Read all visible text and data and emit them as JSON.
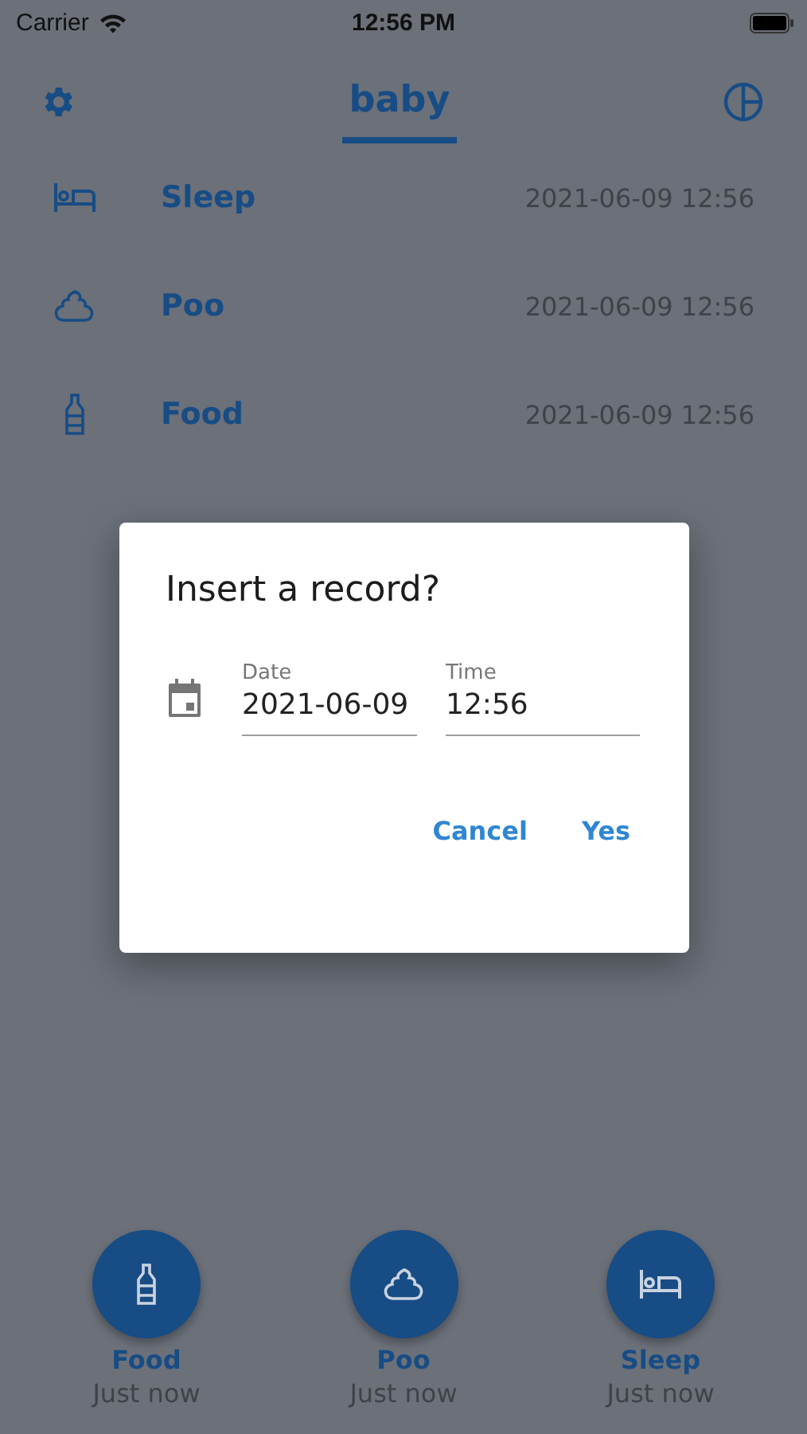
{
  "status_bar": {
    "carrier": "Carrier",
    "time": "12:56 PM"
  },
  "header": {
    "tabs": [
      {
        "label": "baby",
        "selected": true
      }
    ]
  },
  "records": [
    {
      "kind": "sleep",
      "name": "Sleep",
      "time": "2021-06-09 12:56"
    },
    {
      "kind": "poo",
      "name": "Poo",
      "time": "2021-06-09 12:56"
    },
    {
      "kind": "food",
      "name": "Food",
      "time": "2021-06-09 12:56"
    }
  ],
  "dialog": {
    "title": "Insert a record?",
    "fields": [
      {
        "label": "Date",
        "value": "2021-06-09"
      },
      {
        "label": "Time",
        "value": "12:56"
      }
    ],
    "buttons": [
      "Cancel",
      "Yes"
    ]
  },
  "quick_actions": [
    {
      "kind": "food",
      "name": "Food",
      "time": "Just now"
    },
    {
      "kind": "poo",
      "name": "Poo",
      "time": "Just now"
    },
    {
      "kind": "sleep",
      "name": "Sleep",
      "time": "Just now"
    }
  ]
}
